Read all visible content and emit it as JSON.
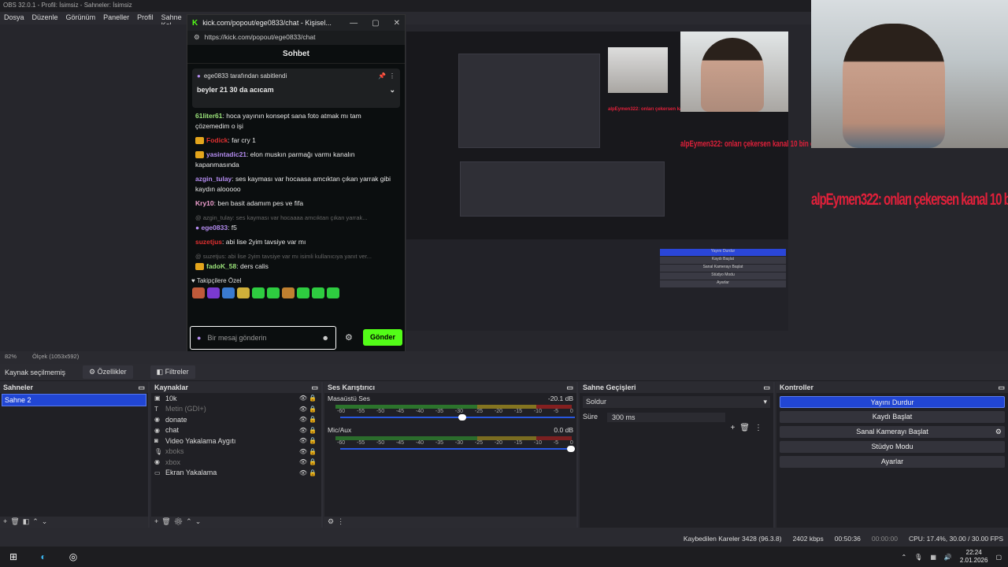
{
  "obs_title": "OBS 32.0.1 - Profil: İsimsiz - Sahneler: İsimsiz",
  "menu": [
    "Dosya",
    "Düzenle",
    "Görünüm",
    "Paneller",
    "Profil",
    "Sahne Kol"
  ],
  "chat_window": {
    "title": "kick.com/popout/ege0833/chat - Kişisel...",
    "url": "https://kick.com/popout/ege0833/chat",
    "header": "Sohbet",
    "pinned_by": "ege0833 tarafından sabitlendi",
    "pinned_message": "beyler 21 30 da acıcam",
    "messages": [
      {
        "user": "61liter61",
        "text": "hoca yayının konsept sana foto atmak mı tam çözemedim o işi",
        "color": "#9be37a",
        "badge": false
      },
      {
        "user": "Fodick",
        "text": "far cry 1",
        "color": "#e03030",
        "badge": true
      },
      {
        "user": "yasintadic21",
        "text": "elon muskın parmağı varmı kanalın kapanmasında",
        "color": "#b48cf0",
        "badge": true
      },
      {
        "user": "azgin_tulay",
        "text": "ses kayması var hocaasa amcıktan çıkan yarrak gibi kaydın alooooo",
        "color": "#b48cf0",
        "badge": false
      },
      {
        "user": "Kry10",
        "text": "ben basit adamım pes ve fifa",
        "color": "#f0a0d0",
        "badge": false
      }
    ],
    "reply1": "@ azgin_tulay: ses kayması var hocaaaa amcıktan çıkan yarrak...",
    "msg6_user": "ege0833",
    "msg6_text": "f5",
    "msg7_user": "suzetjus",
    "msg7_text": "abi lise 2yim tavsiye var mı",
    "reply2": "@ suzetjus: abi lise 2yim tavsiye var mı isimli kullanıcıya yanıt ver...",
    "msg8_user": "fadoK_58",
    "msg8_text": "ders calis",
    "followers_label": "Takipçilere Özel",
    "input_placeholder": "Bir mesaj gönderin",
    "send_label": "Gönder"
  },
  "overlay_text": "alpEymen322: onları çekersen kanal 10 bin olur zaten",
  "zoom": "82%",
  "scale": "Ölçek (1053x592)",
  "source_bar": {
    "none": "Kaynak seçilmemiş",
    "props": "Özellikler",
    "filters": "Filtreler"
  },
  "docks": {
    "scenes": {
      "title": "Sahneler",
      "items": [
        "Sahne 2"
      ]
    },
    "sources": {
      "title": "Kaynaklar",
      "items": [
        {
          "name": "10k",
          "icon": "▣",
          "dim": false
        },
        {
          "name": "Metin (GDI+)",
          "icon": "T",
          "dim": true
        },
        {
          "name": "donate",
          "icon": "◉",
          "dim": false
        },
        {
          "name": "chat",
          "icon": "◉",
          "dim": false
        },
        {
          "name": "Video Yakalama Aygıtı",
          "icon": "◙",
          "dim": false
        },
        {
          "name": "xboks",
          "icon": "🎙",
          "dim": true
        },
        {
          "name": "xbox",
          "icon": "◉",
          "dim": true
        },
        {
          "name": "Ekran Yakalama",
          "icon": "▭",
          "dim": false
        }
      ]
    },
    "mixer": {
      "title": "Ses Karıştırıcı",
      "channels": [
        {
          "name": "Masaüstü Ses",
          "db": "-20.1 dB",
          "level": 0.9,
          "slider": 0.52
        },
        {
          "name": "Mic/Aux",
          "db": "0.0 dB",
          "level": 0.75,
          "slider": 1.0
        }
      ],
      "ticks": [
        "-60",
        "-55",
        "-50",
        "-45",
        "-40",
        "-35",
        "-30",
        "-25",
        "-20",
        "-15",
        "-10",
        "-5",
        "0"
      ]
    },
    "transitions": {
      "title": "Sahne Geçişleri",
      "selected": "Soldur",
      "duration_label": "Süre",
      "duration": "300 ms"
    },
    "controls": {
      "title": "Kontroller",
      "buttons": [
        "Yayını Durdur",
        "Kaydı Başlat",
        "Sanal Kamerayı Başlat",
        "Stüdyo Modu",
        "Ayarlar"
      ]
    }
  },
  "status": {
    "dropped": "Kaybedilen Kareler 3428 (96.3.8)",
    "bitrate": "2402 kbps",
    "stream_time": "00:50:36",
    "rec_time": "00:00:00",
    "cpu": "CPU: 17.4%, 30.00 / 30.00 FPS"
  },
  "clock": {
    "time": "22:24",
    "date": "2.01.2026"
  }
}
